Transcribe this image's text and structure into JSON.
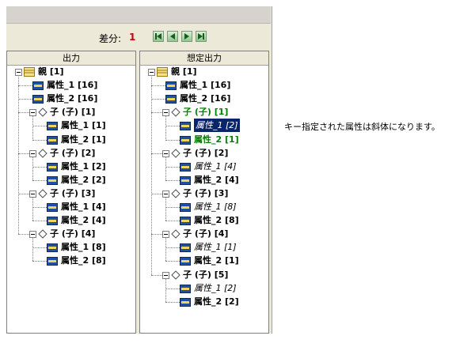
{
  "diff": {
    "label": "差分:",
    "count": "1"
  },
  "columns": {
    "left_title": "出力",
    "right_title": "想定出力"
  },
  "note": "キー指定された属性は斜体になります。",
  "left_tree": [
    {
      "depth": 0,
      "icon": "folder",
      "text": "親 [1]",
      "exp": true
    },
    {
      "depth": 1,
      "icon": "attr",
      "text": "属性_1 [16]"
    },
    {
      "depth": 1,
      "icon": "attr",
      "text": "属性_2 [16]"
    },
    {
      "depth": 1,
      "icon": "diamond",
      "text": "子 (子) [1]",
      "exp": true
    },
    {
      "depth": 2,
      "icon": "attr",
      "text": "属性_1 [1]"
    },
    {
      "depth": 2,
      "icon": "attr",
      "text": "属性_2 [1]"
    },
    {
      "depth": 1,
      "icon": "diamond",
      "text": "子 (子) [2]",
      "exp": true
    },
    {
      "depth": 2,
      "icon": "attr",
      "text": "属性_1 [2]"
    },
    {
      "depth": 2,
      "icon": "attr",
      "text": "属性_2 [2]"
    },
    {
      "depth": 1,
      "icon": "diamond",
      "text": "子 (子) [3]",
      "exp": true
    },
    {
      "depth": 2,
      "icon": "attr",
      "text": "属性_1 [4]"
    },
    {
      "depth": 2,
      "icon": "attr",
      "text": "属性_2 [4]"
    },
    {
      "depth": 1,
      "icon": "diamond",
      "text": "子 (子) [4]",
      "exp": true
    },
    {
      "depth": 2,
      "icon": "attr",
      "text": "属性_1 [8]"
    },
    {
      "depth": 2,
      "icon": "attr",
      "text": "属性_2 [8]"
    }
  ],
  "right_tree": [
    {
      "depth": 0,
      "icon": "folder",
      "text": "親 [1]",
      "exp": true
    },
    {
      "depth": 1,
      "icon": "attr",
      "text": "属性_1 [16]"
    },
    {
      "depth": 1,
      "icon": "attr",
      "text": "属性_2 [16]"
    },
    {
      "depth": 1,
      "icon": "diamond",
      "text": "子 (子) [1]",
      "exp": true,
      "style": "green"
    },
    {
      "depth": 2,
      "icon": "attr",
      "text": "属性_1 [2]",
      "style": "sel"
    },
    {
      "depth": 2,
      "icon": "attr",
      "text": "属性_2 [1]",
      "style": "green"
    },
    {
      "depth": 1,
      "icon": "diamond",
      "text": "子 (子) [2]",
      "exp": true
    },
    {
      "depth": 2,
      "icon": "attr",
      "text": "属性_1 [4]",
      "style": "italic"
    },
    {
      "depth": 2,
      "icon": "attr",
      "text": "属性_2 [4]"
    },
    {
      "depth": 1,
      "icon": "diamond",
      "text": "子 (子) [3]",
      "exp": true
    },
    {
      "depth": 2,
      "icon": "attr",
      "text": "属性_1 [8]",
      "style": "italic"
    },
    {
      "depth": 2,
      "icon": "attr",
      "text": "属性_2 [8]"
    },
    {
      "depth": 1,
      "icon": "diamond",
      "text": "子 (子) [4]",
      "exp": true
    },
    {
      "depth": 2,
      "icon": "attr",
      "text": "属性_1 [1]",
      "style": "italic"
    },
    {
      "depth": 2,
      "icon": "attr",
      "text": "属性_2 [1]"
    },
    {
      "depth": 1,
      "icon": "diamond",
      "text": "子 (子) [5]",
      "exp": true
    },
    {
      "depth": 2,
      "icon": "attr",
      "text": "属性_1 [2]",
      "style": "italic"
    },
    {
      "depth": 2,
      "icon": "attr",
      "text": "属性_2 [2]"
    }
  ],
  "icons": {
    "nav_first": "skip-first-icon",
    "nav_prev": "previous-icon",
    "nav_next": "next-icon",
    "nav_last": "skip-last-icon"
  }
}
